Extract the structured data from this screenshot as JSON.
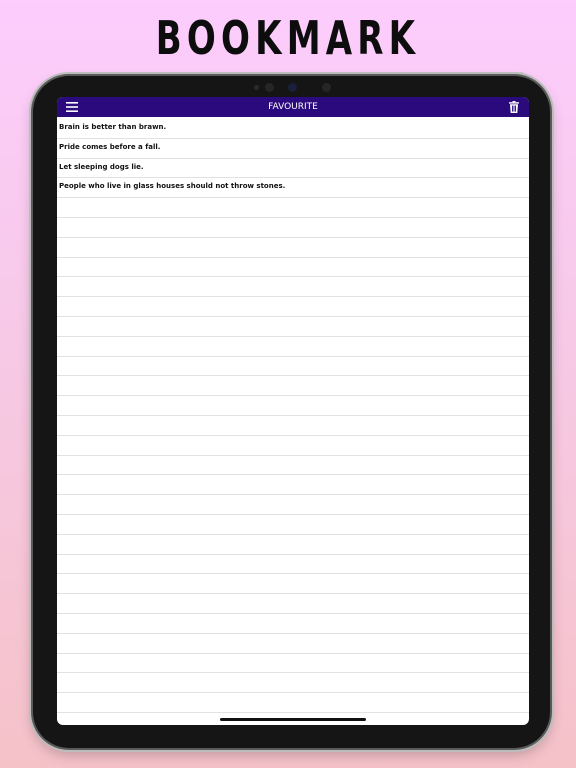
{
  "headline": "BOOKMARK",
  "navbar": {
    "title": "FAVOURITE",
    "background": "#2b0a7d",
    "menu_icon": "hamburger-menu-icon",
    "trash_icon": "trash-icon"
  },
  "favourites": [
    "Brain is better than brawn.",
    "Pride comes before a fall.",
    "Let sleeping dogs lie.",
    "People who live in glass houses should not throw stones."
  ],
  "empty_rows": 26
}
